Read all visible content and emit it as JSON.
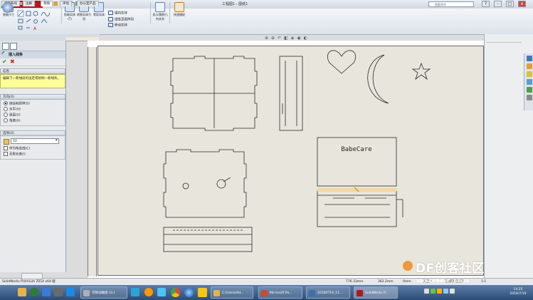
{
  "app": {
    "logo_text": "SOLIDWORKS",
    "doc_title": "工程图1 - 图纸1",
    "search_placeholder": "搜索命令",
    "win_buttons": [
      "?",
      "-",
      "□",
      "x"
    ]
  },
  "ribbon": {
    "left_labels": [
      "智能尺寸"
    ],
    "group1_labels": [
      "剪裁实体(T)",
      "转换实体引用",
      "等距实体"
    ],
    "mirror_items": [
      "镜向实体",
      "线性草图阵列",
      "移动实体"
    ],
    "group2_labels": [
      "显示/删除几何关系",
      "快速捕捉"
    ]
  },
  "tabs": [
    "视图布局",
    "注解",
    "草图",
    "评估",
    "办公室产品"
  ],
  "active_tab": "草图",
  "left_panel": {
    "title": "插入线条",
    "info_header": "信息",
    "info_text": "编辑下一新线段的设定或绘制一新线条。",
    "orientation_header": "方向(O)",
    "orientation_options": [
      "按绘制原样(S)",
      "水平(H)",
      "竖直(V)",
      "角度(A)"
    ],
    "options_header": "选项(O)",
    "dropdown_value": "10",
    "checkboxes": [
      "作为构造线(C)",
      "无限长度(I)"
    ]
  },
  "drawing": {
    "label_text": "BabeCare"
  },
  "status": {
    "left": "SolidWorks Premium 2014 x64 版",
    "x": "776.33mm",
    "y": "362.2mm",
    "z": "0mm",
    "state": "欠定义",
    "mode": "在编辑 图纸1",
    "scale": "1:1"
  },
  "taskbar": {
    "items": [
      "可移动磁盘 (G:)",
      "C:/Users/Ad...",
      "Microsoft Po...",
      "20180719_11...",
      "SolidWorks P..."
    ],
    "time": "14:25",
    "date": "2018/7/19"
  },
  "watermark": {
    "main": "DF创客社区",
    "url": "www.DFRobot.com.cn"
  },
  "colors": {
    "accent": "#b9141a",
    "info_bg": "#ffff99",
    "sheet_bg": "#e8e6dc",
    "taskbar": "#2c4d78"
  }
}
